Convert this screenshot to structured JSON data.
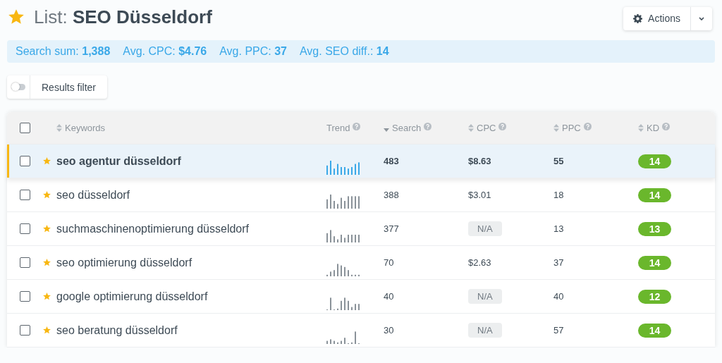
{
  "header": {
    "prefix": "List:",
    "title": "SEO Düsseldorf",
    "starred": true,
    "actions_button": "Actions"
  },
  "summary": [
    {
      "label": "Search sum:",
      "value": "1,388"
    },
    {
      "label": "Avg. CPC:",
      "value": "$4.76"
    },
    {
      "label": "Avg. PPC:",
      "value": "37"
    },
    {
      "label": "Avg. SEO diff.:",
      "value": "14"
    }
  ],
  "filter": {
    "label": "Results filter",
    "on": false
  },
  "table": {
    "all_checked": false,
    "columns": [
      {
        "label": "Keywords",
        "sortable": true,
        "sorted": false,
        "help": false
      },
      {
        "label": "Trend",
        "sortable": false,
        "help": true
      },
      {
        "label": "Search",
        "sortable": true,
        "sorted": true,
        "help": true
      },
      {
        "label": "CPC",
        "sortable": true,
        "sorted": false,
        "help": true
      },
      {
        "label": "PPC",
        "sortable": true,
        "sorted": false,
        "help": true
      },
      {
        "label": "KD",
        "sortable": true,
        "sorted": false,
        "help": true
      }
    ],
    "rows": [
      {
        "selected": true,
        "checked": false,
        "starred": true,
        "keyword": "seo agentur düsseldorf",
        "search": "483",
        "cpc": {
          "kind": "value",
          "text": "$8.63"
        },
        "ppc": "55",
        "kd": "14"
      },
      {
        "selected": false,
        "checked": false,
        "starred": true,
        "keyword": "seo düsseldorf",
        "search": "388",
        "cpc": {
          "kind": "value",
          "text": "$3.01"
        },
        "ppc": "18",
        "kd": "14"
      },
      {
        "selected": false,
        "checked": false,
        "starred": true,
        "keyword": "suchmaschinenoptimierung düsseldorf",
        "search": "377",
        "cpc": {
          "kind": "na",
          "text": "N/A"
        },
        "ppc": "13",
        "kd": "13"
      },
      {
        "selected": false,
        "checked": false,
        "starred": true,
        "keyword": "seo optimierung düsseldorf",
        "search": "70",
        "cpc": {
          "kind": "value",
          "text": "$2.63"
        },
        "ppc": "37",
        "kd": "14"
      },
      {
        "selected": false,
        "checked": false,
        "starred": true,
        "keyword": "google optimierung düsseldorf",
        "search": "40",
        "cpc": {
          "kind": "na",
          "text": "N/A"
        },
        "ppc": "40",
        "kd": "12"
      },
      {
        "selected": false,
        "checked": false,
        "starred": true,
        "keyword": "seo beratung düsseldorf",
        "search": "30",
        "cpc": {
          "kind": "na",
          "text": "N/A"
        },
        "ppc": "57",
        "kd": "14"
      }
    ]
  }
}
